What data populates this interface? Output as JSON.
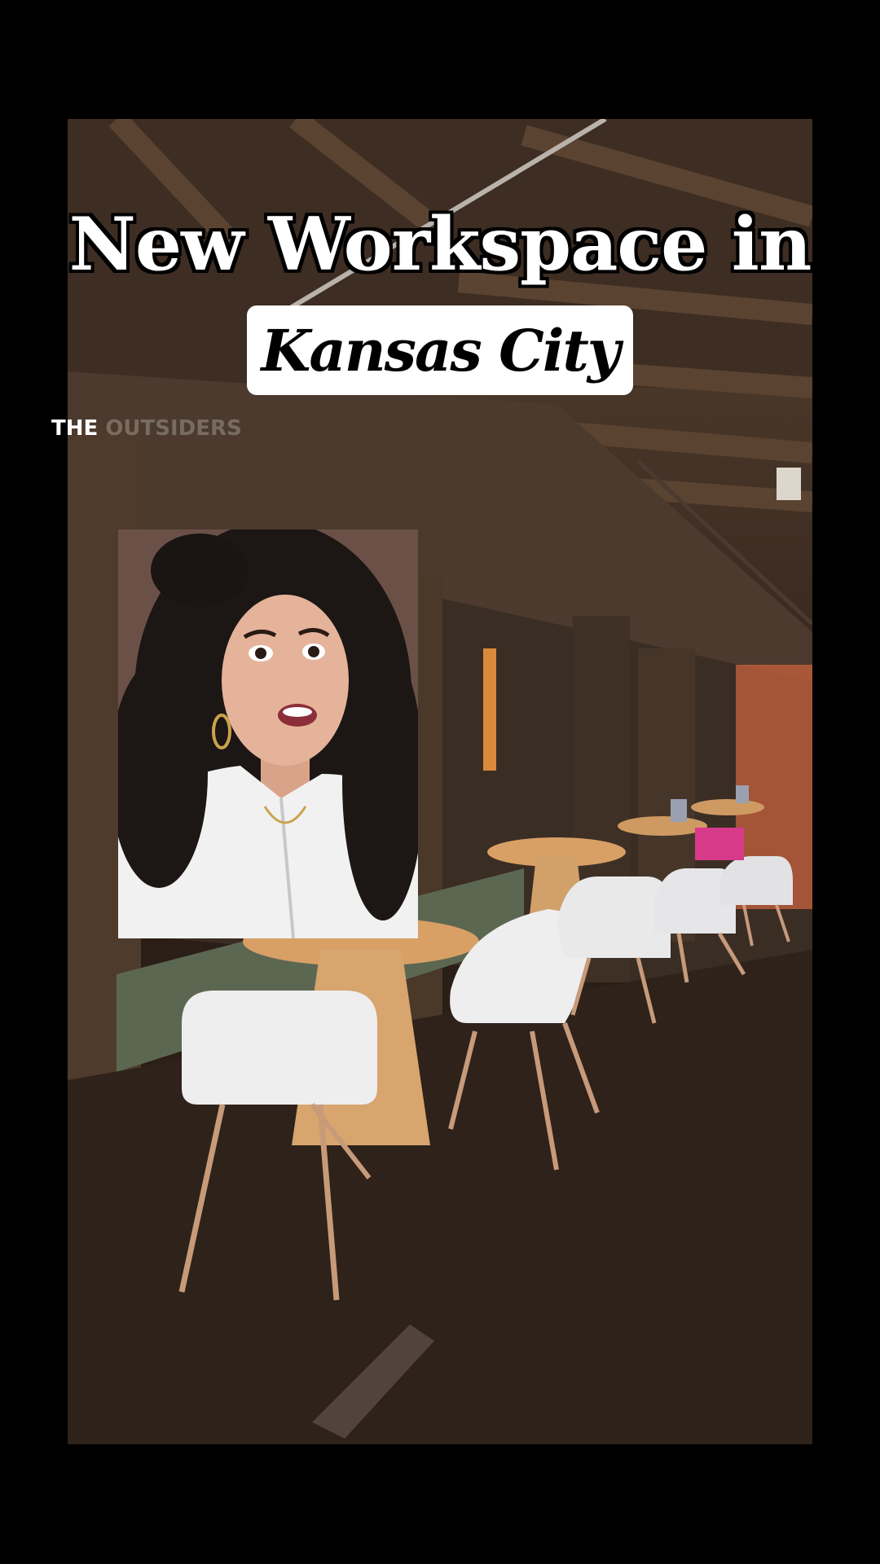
{
  "headline": {
    "line1": "New Workspace in",
    "city": "Kansas City"
  },
  "watermark": {
    "word1": "THE",
    "word2": "OUTSIDERS"
  },
  "media": {
    "scene": "coworking-space-video",
    "facecam": "presenter-reaction"
  },
  "colors": {
    "background": "#000000",
    "headline_text": "#ffffff",
    "pill_bg": "#ffffff",
    "pill_text": "#000000"
  }
}
